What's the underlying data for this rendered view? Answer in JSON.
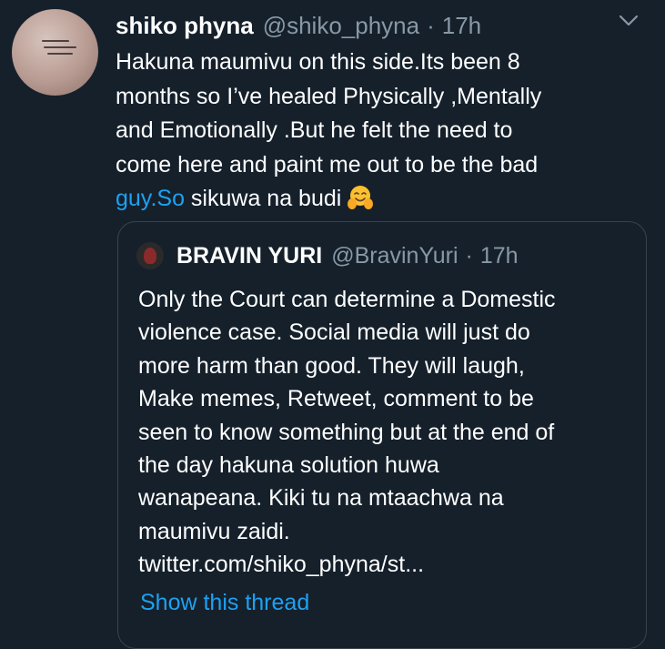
{
  "tweet": {
    "display_name": "shiko phyna",
    "handle": "@shiko_phyna",
    "separator": "·",
    "time": "17h",
    "text_lines": [
      "Hakuna maumivu on this side.Its been 8",
      "months so I’ve healed Physically ,Mentally",
      "and Emotionally .But he felt the need to",
      "come here and paint me out to be the bad"
    ],
    "last_line_link": "guy.So",
    "last_line_rest": " sikuwa na budi",
    "emoji": "hugging-face-emoji"
  },
  "quote": {
    "display_name": "BRAVIN YURI",
    "handle": "@BravinYuri",
    "separator": "·",
    "time": "17h",
    "text_lines": [
      "Only the Court can determine a Domestic",
      "violence case. Social media will just do",
      "more harm than  good. They will laugh,",
      "Make memes, Retweet, comment to be",
      "seen to know something but at the end of",
      "the day hakuna solution huwa",
      "wanapeana. Kiki tu na mtaachwa na",
      "maumivu zaidi.",
      "twitter.com/shiko_phyna/st..."
    ],
    "show_thread": "Show this thread"
  },
  "colors": {
    "background": "#15202b",
    "text": "#ffffff",
    "secondary": "#8899a6",
    "link": "#1da1f2",
    "border": "#38444d"
  }
}
